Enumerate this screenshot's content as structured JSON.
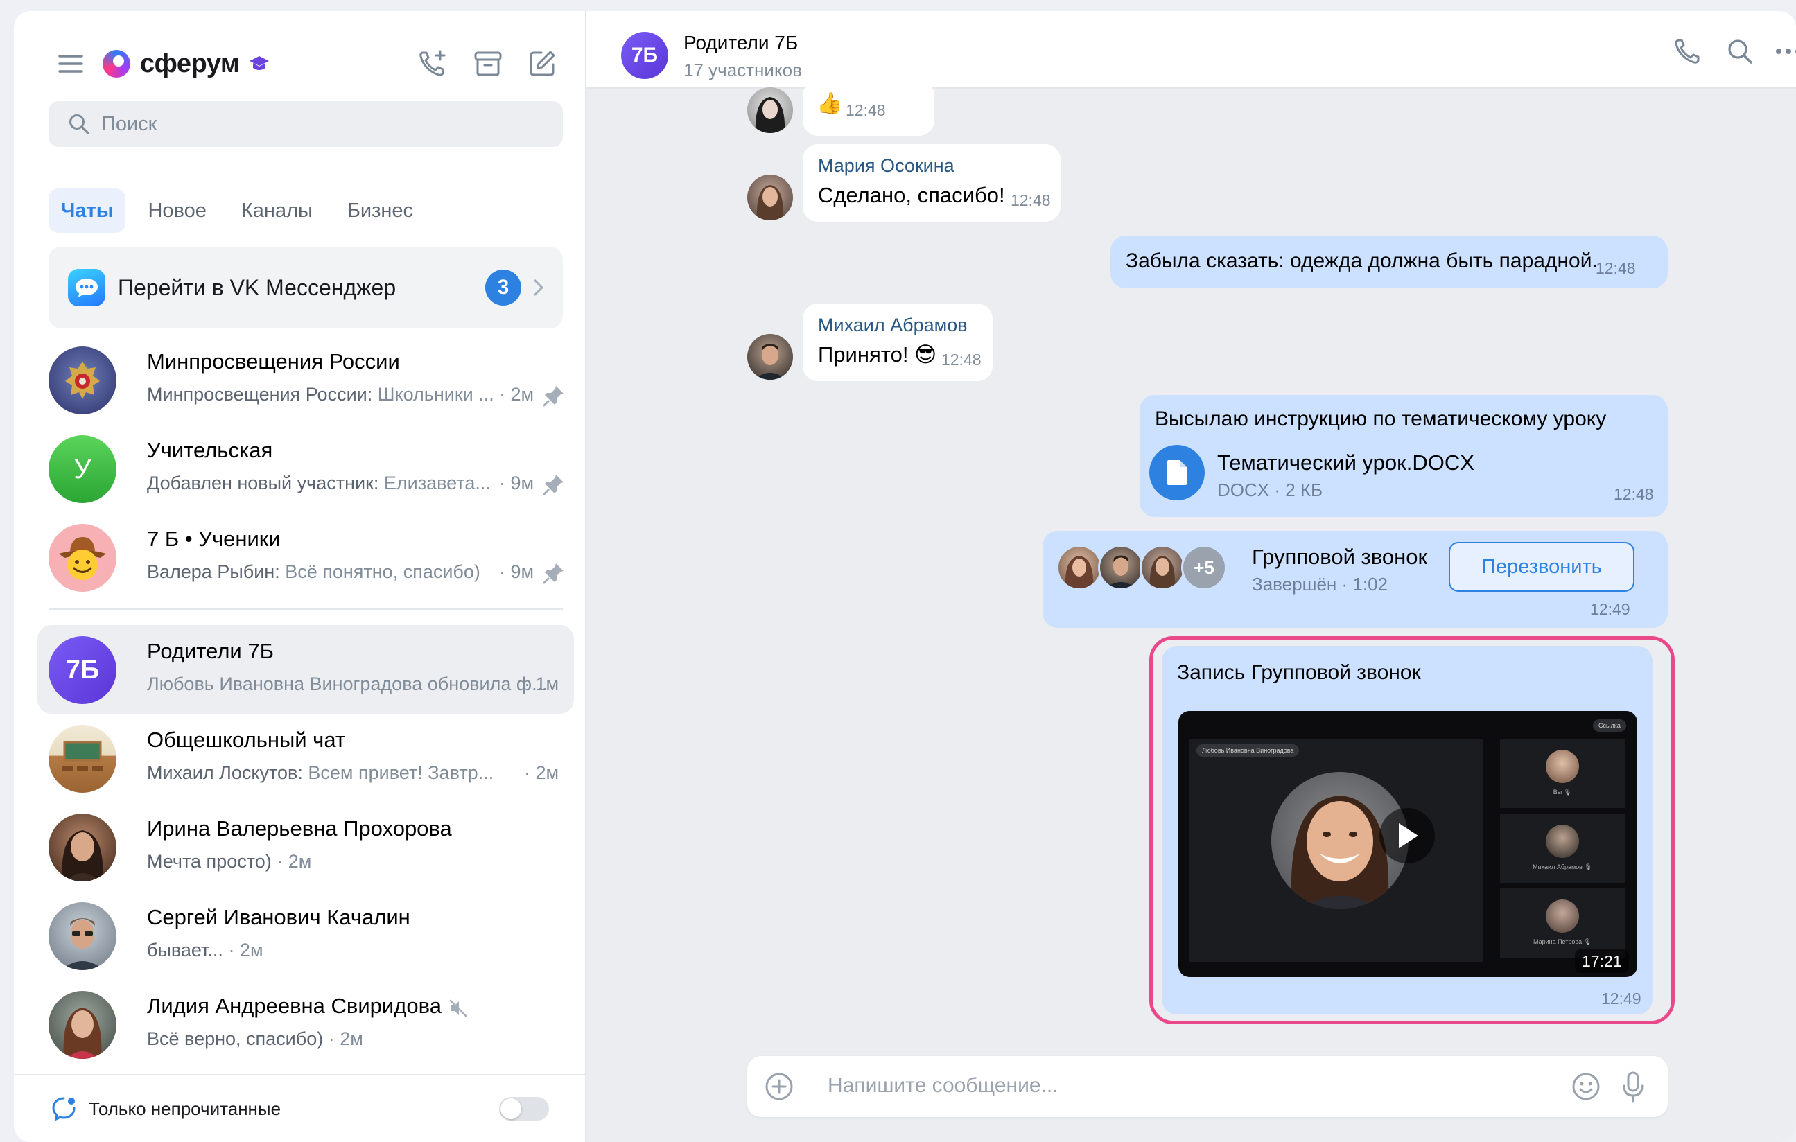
{
  "sidebar": {
    "logo_text": "сферум",
    "search_placeholder": "Поиск",
    "tabs": [
      "Чаты",
      "Новое",
      "Каналы",
      "Бизнес"
    ],
    "vk_banner": {
      "label": "Перейти в VK Мессенджер",
      "badge": "3"
    },
    "chats": [
      {
        "title": "Минпросвещения России",
        "sender": "Минпросвещения России:",
        "preview": " Школьники ...",
        "time": "· 2м",
        "pinned": true
      },
      {
        "title": "Учительская",
        "avatar_letter": "У",
        "sender": "Добавлен новый участник:",
        "preview": " Елизавета...",
        "time": "· 9м",
        "pinned": true
      },
      {
        "title": "7 Б • Ученики",
        "sender": "Валера Рыбин:",
        "preview": " Всё понятно, спасибо)",
        "time": "· 9м",
        "pinned": true
      },
      {
        "title": "Родители 7Б",
        "avatar_letter": "7Б",
        "sender": "",
        "preview": "Любовь Ивановна Виноградова обновила ф...",
        "time": "· 1м",
        "pinned": false
      },
      {
        "title": "Общешкольный чат",
        "sender": "Михаил Лоскутов:",
        "preview": " Всем привет! Завтр...",
        "time": "· 2м",
        "pinned": false
      },
      {
        "title": "Ирина Валерьевна Прохорова",
        "sender": "",
        "preview": "Мечта просто)",
        "time": " · 2м",
        "pinned": false
      },
      {
        "title": "Сергей Иванович Качалин",
        "sender": "",
        "preview": "бывает...",
        "time": " · 2м",
        "pinned": false
      },
      {
        "title": "Лидия Андреевна Свиридова",
        "sender": "",
        "preview": "Всё верно, спасибо)",
        "time": " · 2м",
        "pinned": false,
        "muted": true
      }
    ],
    "footer_label": "Только непрочитанные"
  },
  "conversation": {
    "avatar_text": "7Б",
    "title": "Родители 7Б",
    "members": "17 участников",
    "messages": [
      {
        "emoji": "👍",
        "time": "12:48"
      },
      {
        "sender": "Мария Осокина",
        "text": "Сделано, спасибо!",
        "time": "12:48"
      },
      {
        "text": "Забыла сказать: одежда должна быть парадной.",
        "time": "12:48"
      },
      {
        "sender": "Михаил Абрамов",
        "text": "Принято! 😎",
        "time": "12:48"
      },
      {
        "text": "Высылаю инструкцию по тематическому уроку",
        "file_name": "Тематический урок.DOCX",
        "file_meta": "DOCX · 2 КБ",
        "time": "12:48"
      },
      {
        "call_title": "Групповой звонок",
        "call_meta": "Завершён · 1:02",
        "more": "+5",
        "action": "Перезвонить",
        "time": "12:49"
      },
      {
        "text": "Запись Групповой звонок",
        "video_caption": "Любовь Ивановна Виноградова",
        "video_badge": "Ссылка",
        "duration": "17:21",
        "tiles": [
          "Вы 🎙",
          "Михаил Абрамов 🎙",
          "Марина Петрова 🎙"
        ],
        "time": "12:49"
      }
    ],
    "composer_placeholder": "Напишите сообщение..."
  },
  "colors": {
    "accent": "#2d81e0",
    "outgoing": "#cce0ff",
    "highlight": "#e9498b"
  }
}
